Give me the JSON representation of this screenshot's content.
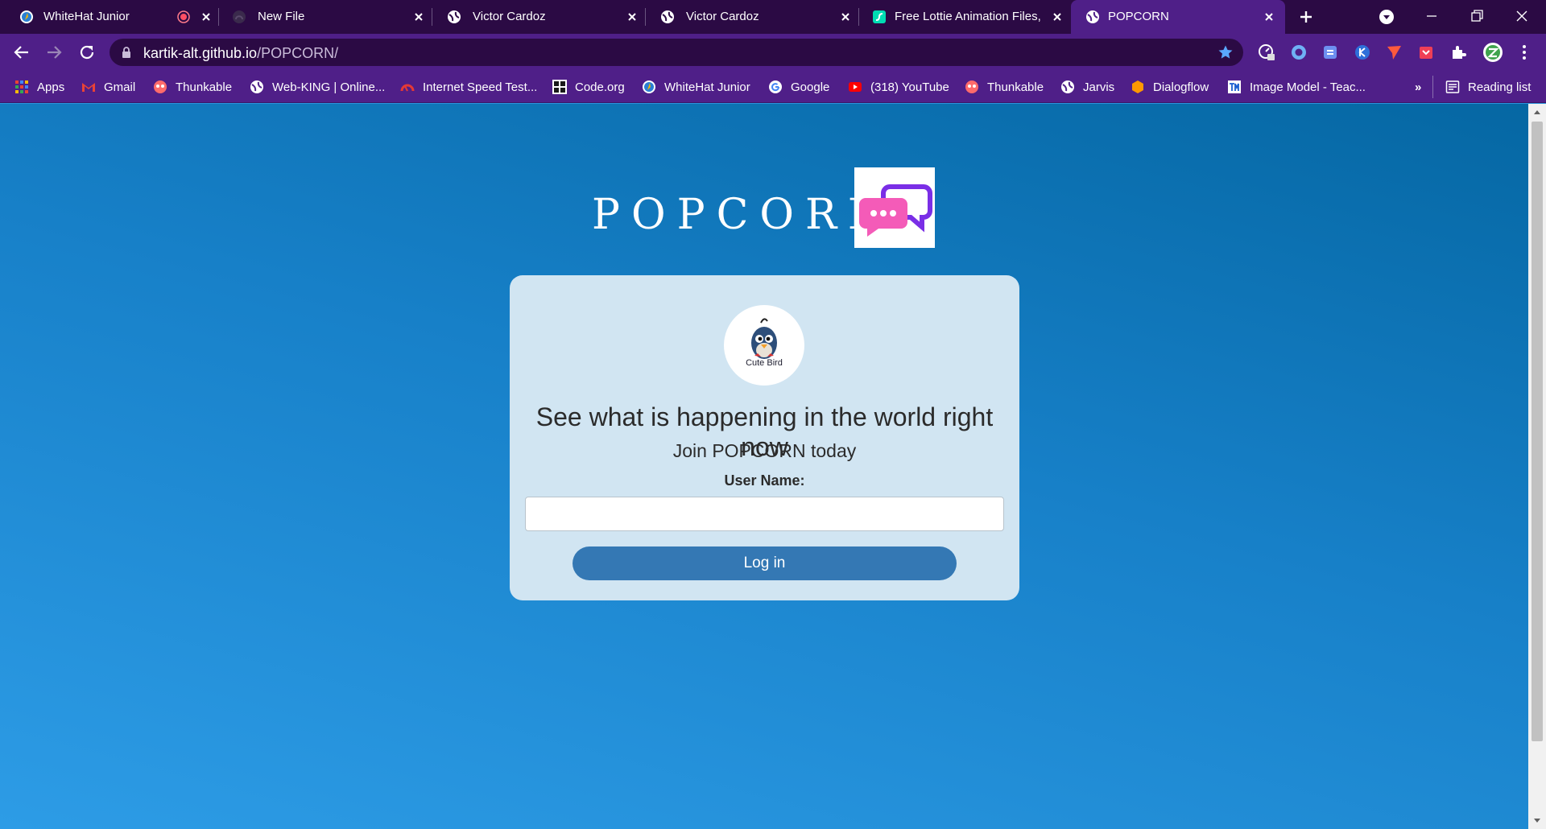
{
  "browser": {
    "tabs": [
      {
        "title": "WhiteHat Junior",
        "favicon": "whitehat-icon"
      },
      {
        "title": "New File",
        "favicon": "github-icon"
      },
      {
        "title": "Victor Cardoz",
        "favicon": "globe-icon"
      },
      {
        "title": "Victor Cardoz",
        "favicon": "globe-icon"
      },
      {
        "title": "Free Lottie Animation Files,",
        "favicon": "lottie-icon"
      },
      {
        "title": "POPCORN",
        "favicon": "globe-icon",
        "active": true
      }
    ],
    "address": {
      "host": "kartik-alt.github.io",
      "path": "/POPCORN/"
    },
    "bookmarks": [
      {
        "label": "Apps",
        "icon": "apps-grid-icon"
      },
      {
        "label": "Gmail",
        "icon": "gmail-icon"
      },
      {
        "label": "Thunkable",
        "icon": "thunkable-icon"
      },
      {
        "label": "Web-KING | Online...",
        "icon": "globe-icon"
      },
      {
        "label": "Internet Speed Test...",
        "icon": "speedtest-icon"
      },
      {
        "label": "Code.org",
        "icon": "codeorg-icon"
      },
      {
        "label": "WhiteHat Junior",
        "icon": "whitehat-icon"
      },
      {
        "label": "Google",
        "icon": "google-icon"
      },
      {
        "label": "(318) YouTube",
        "icon": "youtube-icon"
      },
      {
        "label": "Thunkable",
        "icon": "thunkable-icon"
      },
      {
        "label": "Jarvis",
        "icon": "globe-icon"
      },
      {
        "label": "Dialogflow",
        "icon": "dialogflow-icon"
      },
      {
        "label": "Image Model - Teac...",
        "icon": "teachable-machine-icon"
      }
    ],
    "bookmarks_overflow": "»",
    "reading_list": "Reading list"
  },
  "app": {
    "brand": "POPCORN",
    "avatar_caption": "Cute Bird",
    "headline": "See what is happening in the world right now",
    "subheadline": "Join POPCORN today",
    "username_label": "User Name:",
    "username_value": "",
    "login_label": "Log in"
  },
  "colors": {
    "tabstrip": "#2b0a44",
    "toolbar": "#4f1f88",
    "page_top": "#0567a3",
    "page_bottom": "#2d9ce6",
    "card": "#d1e5f2",
    "button": "#3478b4"
  }
}
